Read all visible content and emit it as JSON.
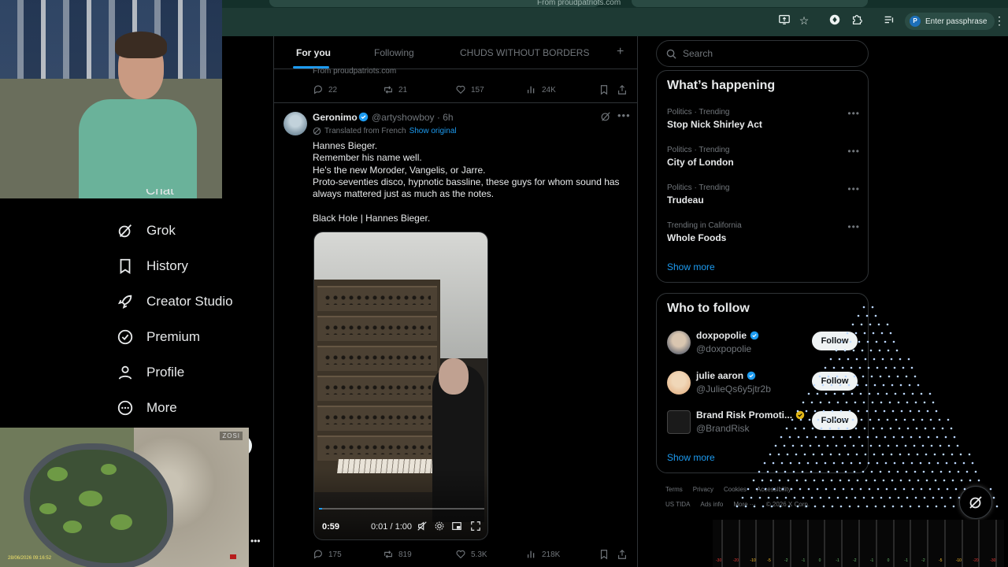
{
  "browser": {
    "url_fragment": "From proudpatriots.com",
    "passphrase_chip": {
      "avatar_letter": "P",
      "label": "Enter passphrase"
    },
    "icons": [
      "screen-share-icon",
      "star-icon",
      "extension-shield-icon",
      "puzzle-icon",
      "queue-music-icon",
      "kebab-menu-icon"
    ]
  },
  "cctv": {
    "logo": "ZOSI",
    "timestamp": "28/06/2026 09:16:52"
  },
  "nav": {
    "partial_label": "Chat",
    "items": [
      {
        "label": "Grok",
        "icon": "grok-icon"
      },
      {
        "label": "History",
        "icon": "bookmark-icon"
      },
      {
        "label": "Creator Studio",
        "icon": "rocket-icon"
      },
      {
        "label": "Premium",
        "icon": "verified-check-icon"
      },
      {
        "label": "Profile",
        "icon": "person-icon"
      },
      {
        "label": "More",
        "icon": "more-circle-icon"
      }
    ],
    "more_dots": "•••"
  },
  "timeline": {
    "tabs": [
      "For you",
      "Following",
      "CHUDS WITHOUT BORDERS"
    ],
    "active_tab": "For you",
    "add_tab": "+",
    "previous_post": {
      "source": "From proudpatriots.com",
      "replies": "22",
      "reposts": "21",
      "likes": "157",
      "views": "24K"
    },
    "post": {
      "author": "Geronimo",
      "handle": "@artyshowboy · 6h",
      "translated_label": "Translated from French",
      "show_original": "Show original",
      "lines": [
        "Hannes Bieger.",
        "Remember his name well.",
        "He's the new Moroder, Vangelis, or Jarre.",
        "Proto-seventies disco, hypnotic bassline, these guys for whom sound has",
        "always mattered just as much as the notes.",
        "",
        "Black Hole | Hannes Bieger."
      ],
      "video": {
        "duration_badge": "0:59",
        "time": "0:01 / 1:00",
        "progress": 0.017
      },
      "replies": "175",
      "reposts": "819",
      "likes": "5.3K",
      "views": "218K"
    }
  },
  "sidebar_right": {
    "search_placeholder": "Search",
    "trends_title": "What’s happening",
    "trends": [
      {
        "category": "Politics · Trending",
        "name": "Stop Nick Shirley Act"
      },
      {
        "category": "Politics · Trending",
        "name": "City of London"
      },
      {
        "category": "Politics · Trending",
        "name": "Trudeau"
      },
      {
        "category": "Trending in California",
        "name": "Whole Foods"
      }
    ],
    "trends_show_more": "Show more",
    "follow_title": "Who to follow",
    "who_to_follow": [
      {
        "name": "doxpopolie",
        "handle": "@doxpopolie",
        "badge": "blue",
        "button": "Follow"
      },
      {
        "name": "julie aaron",
        "handle": "@JulieQs6y5jtr2b",
        "badge": "blue",
        "button": "Follow"
      },
      {
        "name": "Brand Risk Promoti...",
        "handle": "@BrandRisk",
        "badge": "gold",
        "button": "Follow"
      }
    ],
    "follow_show_more": "Show more",
    "footer": {
      "row1": [
        "Terms",
        "Privacy",
        "Cookies",
        "Accessibility"
      ],
      "row2": [
        "US TIDA",
        "Ads info",
        "More ···",
        "© 2026 X Corp."
      ]
    }
  },
  "audio_meter_labels": [
    "-30",
    "-20",
    "-10",
    "-5",
    "-2",
    "-1",
    "0",
    "-1",
    "-2",
    "-1",
    "0",
    "-1",
    "-2",
    "-5",
    "-10",
    "-20",
    "-30"
  ],
  "colors": {
    "accent": "#1d9bf0",
    "background": "#000000",
    "border": "#2f3336",
    "muted": "#71767b",
    "gold_badge": "#e2b719"
  }
}
